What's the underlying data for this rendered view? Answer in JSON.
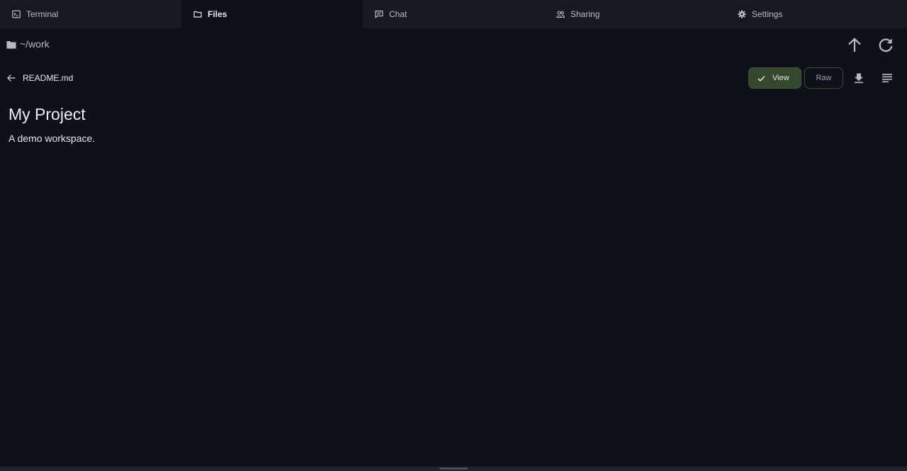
{
  "tabs": [
    {
      "label": "Terminal",
      "icon": "terminal-icon",
      "active": false
    },
    {
      "label": "Files",
      "icon": "folder-icon",
      "active": true
    },
    {
      "label": "Chat",
      "icon": "chat-icon",
      "active": false
    },
    {
      "label": "Sharing",
      "icon": "people-icon",
      "active": false
    },
    {
      "label": "Settings",
      "icon": "gear-icon",
      "active": false
    }
  ],
  "path": {
    "text": "~/work",
    "icon": "folder-icon"
  },
  "file": {
    "name": "README.md",
    "view_label": "View",
    "raw_label": "Raw",
    "view_mode": "View"
  },
  "document": {
    "title": "My Project",
    "body": "A demo workspace."
  },
  "colors": {
    "background": "#0d1119",
    "tab_inactive": "#141923",
    "view_active": "#34472f",
    "raw_border": "#3c4a36"
  }
}
